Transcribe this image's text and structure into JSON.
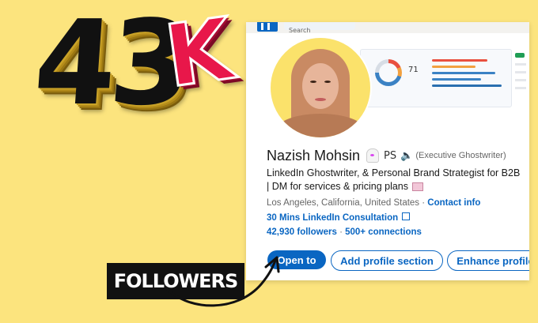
{
  "graphic": {
    "count_text": "43",
    "k_text": "K",
    "badge_label": "FOLLOWERS"
  },
  "colors": {
    "background": "#fce47e",
    "linkedin_blue": "#0a66c2",
    "k_red": "#e8174a",
    "badge_black": "#111111"
  },
  "search": {
    "placeholder": "Search"
  },
  "dashboard": {
    "score": "71"
  },
  "profile": {
    "name": "Nazish Mohsin",
    "initials": "PS",
    "pronunciation": "(Executive Ghostwriter)",
    "headline_line1": "LinkedIn Ghostwriter, & Personal Brand Strategist for B2B",
    "headline_line2": "| DM for services & pricing plans",
    "location": "Los Angeles, California, United States",
    "contact_link": "Contact info",
    "featured_link": "30 Mins LinkedIn Consultation",
    "followers": "42,930 followers",
    "connections": "500+ connections"
  },
  "actions": {
    "open_to": "Open to",
    "add_section": "Add profile section",
    "enhance": "Enhance profile"
  },
  "icons": [
    "linkedin-logo-icon",
    "ghost-emoji-icon",
    "speaker-icon",
    "mail-emoji-icon",
    "external-link-icon",
    "arrow-icon"
  ]
}
